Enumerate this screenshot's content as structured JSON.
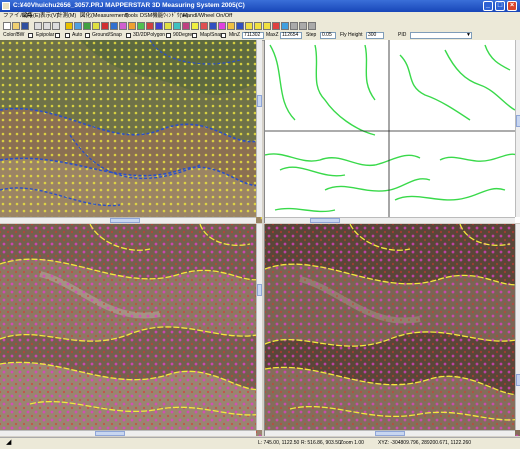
{
  "window": {
    "title": "C:¥40Vhuichu2656_3057.PRJ  MAPPERSTAR 3D Measuring System 2005(C)",
    "minimize": "_",
    "maximize": "□",
    "close": "×"
  },
  "menu": [
    "ファイル(F)",
    "編集(E)",
    "表示(V)",
    "計測(M)",
    "図化(Measurement)",
    "Tools",
    "DSM機能",
    "ｳｨﾝﾄﾞｳ(W)",
    "Handl/Wheel On/Off"
  ],
  "options": {
    "color_bw": "Color/BW",
    "epipolar": "Epipolar",
    "auto": "Auto",
    "ground_snap": "Ground/Snap",
    "view_3d2d": "3D/2D",
    "polygon": "Polygon",
    "degree": "90Degree",
    "map_snap": "Map/Snap",
    "minz_label": "MinZ",
    "minz_value": "711302",
    "maxz_label": "MaxZ",
    "maxz_value": "112654",
    "step_label": "Step",
    "step_value": "0.05",
    "fly_height_label": "Fly Height",
    "fly_height_value": "300",
    "pid_label": "PID"
  },
  "status": {
    "left_pos": "L: 745.00, 1122.50",
    "right_pos": "R: 516.86, 903.50",
    "zoom": "Zoom 1.00",
    "xyz": "XYZ: -304809.796, 289200.671, 1122.260"
  },
  "colors": {
    "accent_title": "#1846b8",
    "contour_green": "#39d94a",
    "contour_yellow": "#f2e83c",
    "point_magenta": "#e040c8",
    "crosshair": "#202020"
  }
}
